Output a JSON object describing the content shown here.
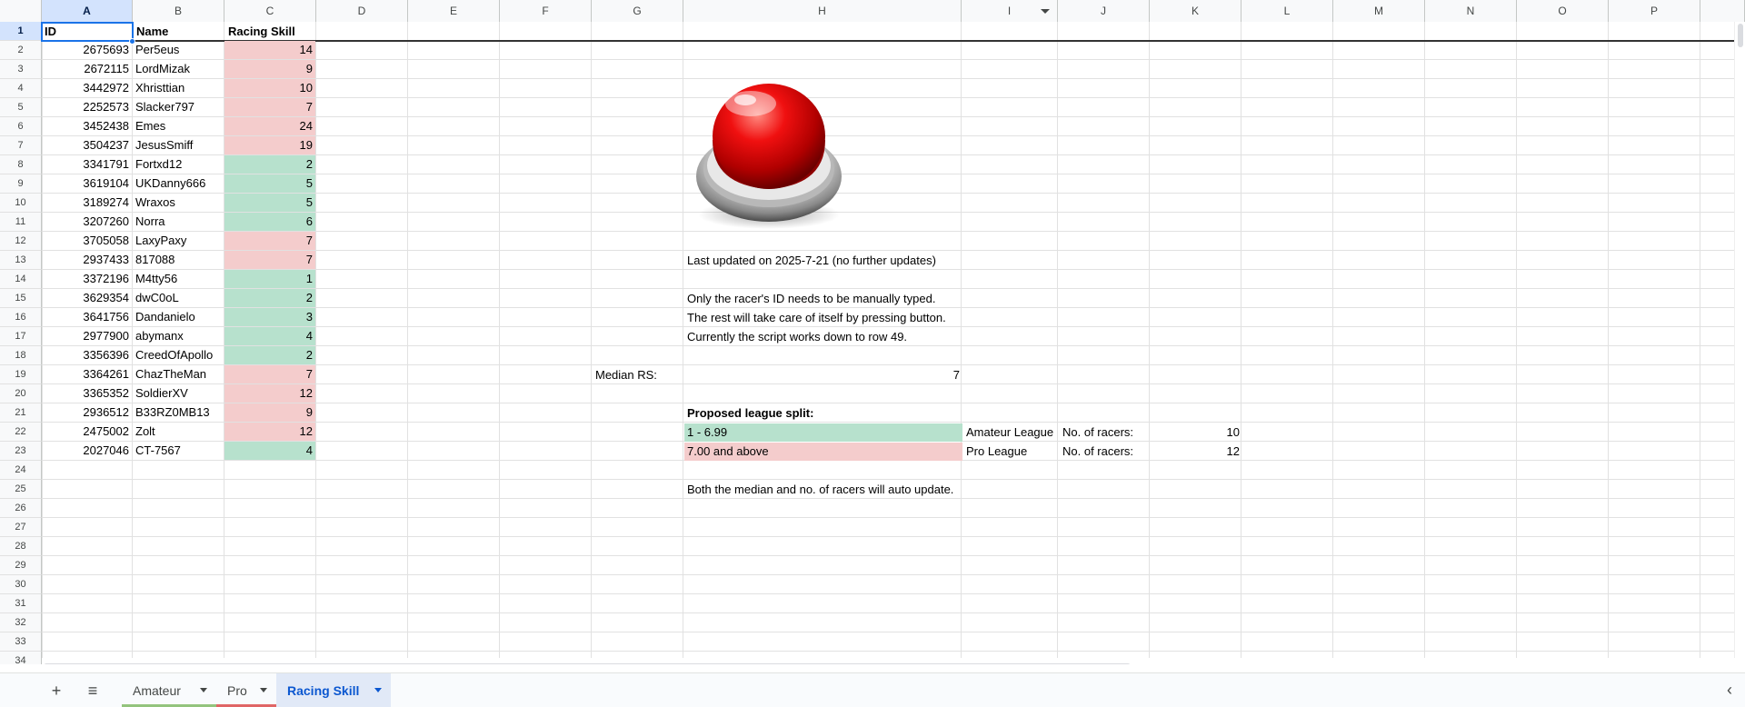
{
  "columns": [
    "A",
    "B",
    "C",
    "D",
    "E",
    "F",
    "G",
    "H",
    "I",
    "J",
    "K",
    "L",
    "M",
    "N",
    "O",
    "P"
  ],
  "rows": [
    "1",
    "2",
    "3",
    "4",
    "5",
    "6",
    "7",
    "8",
    "9",
    "10",
    "11",
    "12",
    "13",
    "14",
    "15",
    "16",
    "17",
    "18",
    "19",
    "20",
    "21",
    "22",
    "23",
    "24",
    "25",
    "26",
    "27",
    "28",
    "29",
    "30",
    "31",
    "32",
    "33",
    "34"
  ],
  "headers": {
    "id": "ID",
    "name": "Name",
    "skill": "Racing Skill"
  },
  "racers": [
    {
      "id": "2675693",
      "name": "Per5eus",
      "skill": "14",
      "tier": "pro"
    },
    {
      "id": "2672115",
      "name": "LordMizak",
      "skill": "9",
      "tier": "pro"
    },
    {
      "id": "3442972",
      "name": "Xhristtian",
      "skill": "10",
      "tier": "pro"
    },
    {
      "id": "2252573",
      "name": "Slacker797",
      "skill": "7",
      "tier": "pro"
    },
    {
      "id": "3452438",
      "name": "Emes",
      "skill": "24",
      "tier": "pro"
    },
    {
      "id": "3504237",
      "name": "JesusSmiff",
      "skill": "19",
      "tier": "pro"
    },
    {
      "id": "3341791",
      "name": "Fortxd12",
      "skill": "2",
      "tier": "amateur"
    },
    {
      "id": "3619104",
      "name": "UKDanny666",
      "skill": "5",
      "tier": "amateur"
    },
    {
      "id": "3189274",
      "name": "Wraxos",
      "skill": "5",
      "tier": "amateur"
    },
    {
      "id": "3207260",
      "name": "Norra",
      "skill": "6",
      "tier": "amateur"
    },
    {
      "id": "3705058",
      "name": "LaxyPaxy",
      "skill": "7",
      "tier": "pro"
    },
    {
      "id": "2937433",
      "name": "817088",
      "skill": "7",
      "tier": "pro"
    },
    {
      "id": "3372196",
      "name": "M4tty56",
      "skill": "1",
      "tier": "amateur"
    },
    {
      "id": "3629354",
      "name": "dwC0oL",
      "skill": "2",
      "tier": "amateur"
    },
    {
      "id": "3641756",
      "name": "Dandanielo",
      "skill": "3",
      "tier": "amateur"
    },
    {
      "id": "2977900",
      "name": "abymanx",
      "skill": "4",
      "tier": "amateur"
    },
    {
      "id": "3356396",
      "name": "CreedOfApollo",
      "skill": "2",
      "tier": "amateur"
    },
    {
      "id": "3364261",
      "name": "ChazTheMan",
      "skill": "7",
      "tier": "pro"
    },
    {
      "id": "3365352",
      "name": "SoldierXV",
      "skill": "12",
      "tier": "pro"
    },
    {
      "id": "2936512",
      "name": "B33RZ0MB13",
      "skill": "9",
      "tier": "pro"
    },
    {
      "id": "2475002",
      "name": "Zolt",
      "skill": "12",
      "tier": "pro"
    },
    {
      "id": "2027046",
      "name": "CT-7567",
      "skill": "4",
      "tier": "amateur"
    }
  ],
  "notes": {
    "last_updated": "Last updated on 2025-7-21 (no further updates)",
    "line1": "Only the racer's ID needs to be manually typed.",
    "line2": "The rest will take care of itself by pressing button.",
    "line3": "Currently the script works down to row 49.",
    "median_label": "Median RS:",
    "median_value": "7",
    "split_title": "Proposed league split:",
    "amateur_range": "1 - 6.99",
    "pro_range": "7.00 and above",
    "amateur_league": "Amateur League",
    "pro_league": "Pro League",
    "count_label": "No. of racers:",
    "amateur_count": "10",
    "pro_count": "12",
    "footer": "Both the median and no. of racers will auto update."
  },
  "colors": {
    "amateur": "#b7e1cd",
    "pro": "#f4cccc",
    "selection": "#1a73e8",
    "active_tab": "#0b57d0"
  },
  "button_icon": "red-push-button",
  "tabs": [
    {
      "label": "Amateur",
      "color": "#93c47d",
      "active": false
    },
    {
      "label": "Pro",
      "color": "#e06666",
      "active": false
    },
    {
      "label": "Racing Skill",
      "color": "",
      "active": true
    }
  ],
  "tabbar_icons": {
    "add": "plus-icon",
    "all_sheets": "menu-icon",
    "collapse": "chevron-left-icon"
  }
}
